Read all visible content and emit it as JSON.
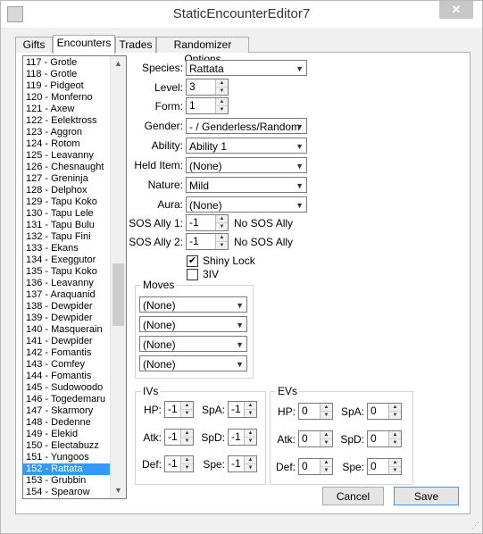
{
  "window": {
    "title": "StaticEncounterEditor7",
    "close_glyph": "✕"
  },
  "tabs": [
    "Gifts",
    "Encounters",
    "Trades",
    "Randomizer Options"
  ],
  "list": {
    "items": [
      "117 - Grotle",
      "118 - Grotle",
      "119 - Pidgeot",
      "120 - Monferno",
      "121 - Axew",
      "122 - Eelektross",
      "123 - Aggron",
      "124 - Rotom",
      "125 - Leavanny",
      "126 - Chesnaught",
      "127 - Greninja",
      "128 - Delphox",
      "129 - Tapu Koko",
      "130 - Tapu Lele",
      "131 - Tapu Bulu",
      "132 - Tapu Fini",
      "133 - Ekans",
      "134 - Exeggutor",
      "135 - Tapu Koko",
      "136 - Leavanny",
      "137 - Araquanid",
      "138 - Dewpider",
      "139 - Dewpider",
      "140 - Masquerain",
      "141 - Dewpider",
      "142 - Fomantis",
      "143 - Comfey",
      "144 - Fomantis",
      "145 - Sudowoodo",
      "146 - Togedemaru",
      "147 - Skarmory",
      "148 - Dedenne",
      "149 - Elekid",
      "150 - Electabuzz",
      "151 - Yungoos",
      "152 - Rattata",
      "153 - Grubbin",
      "154 - Spearow"
    ],
    "selected_index": 35
  },
  "form": {
    "species_label": "Species:",
    "species": "Rattata",
    "level_label": "Level:",
    "level": "3",
    "form_label": "Form:",
    "form": "1",
    "gender_label": "Gender:",
    "gender": "- / Genderless/Random",
    "ability_label": "Ability:",
    "ability": "Ability 1",
    "held_item_label": "Held Item:",
    "held_item": "(None)",
    "nature_label": "Nature:",
    "nature": "Mild",
    "aura_label": "Aura:",
    "aura": "(None)",
    "sos1_label": "SOS Ally 1:",
    "sos1": "-1",
    "sos1_text": "No SOS Ally",
    "sos2_label": "SOS Ally 2:",
    "sos2": "-1",
    "sos2_text": "No SOS Ally",
    "shiny_lock_label": "Shiny Lock",
    "shiny_lock": true,
    "three_iv_label": "3IV",
    "three_iv": false
  },
  "moves": {
    "label": "Moves",
    "values": [
      "(None)",
      "(None)",
      "(None)",
      "(None)"
    ]
  },
  "ivs": {
    "label": "IVs",
    "hp_label": "HP:",
    "hp": "-1",
    "atk_label": "Atk:",
    "atk": "-1",
    "def_label": "Def:",
    "def": "-1",
    "spa_label": "SpA:",
    "spa": "-1",
    "spd_label": "SpD:",
    "spd": "-1",
    "spe_label": "Spe:",
    "spe": "-1"
  },
  "evs": {
    "label": "EVs",
    "hp_label": "HP:",
    "hp": "0",
    "atk_label": "Atk:",
    "atk": "0",
    "def_label": "Def:",
    "def": "0",
    "spa_label": "SpA:",
    "spa": "0",
    "spd_label": "SpD:",
    "spd": "0",
    "spe_label": "Spe:",
    "spe": "0"
  },
  "buttons": {
    "cancel": "Cancel",
    "save": "Save"
  },
  "icons": {
    "dropdown": "▼",
    "spin_up": "▲",
    "spin_down": "▼",
    "scroll_up": "▲",
    "scroll_down": "▼",
    "check": "✔",
    "grip": "⋰"
  }
}
